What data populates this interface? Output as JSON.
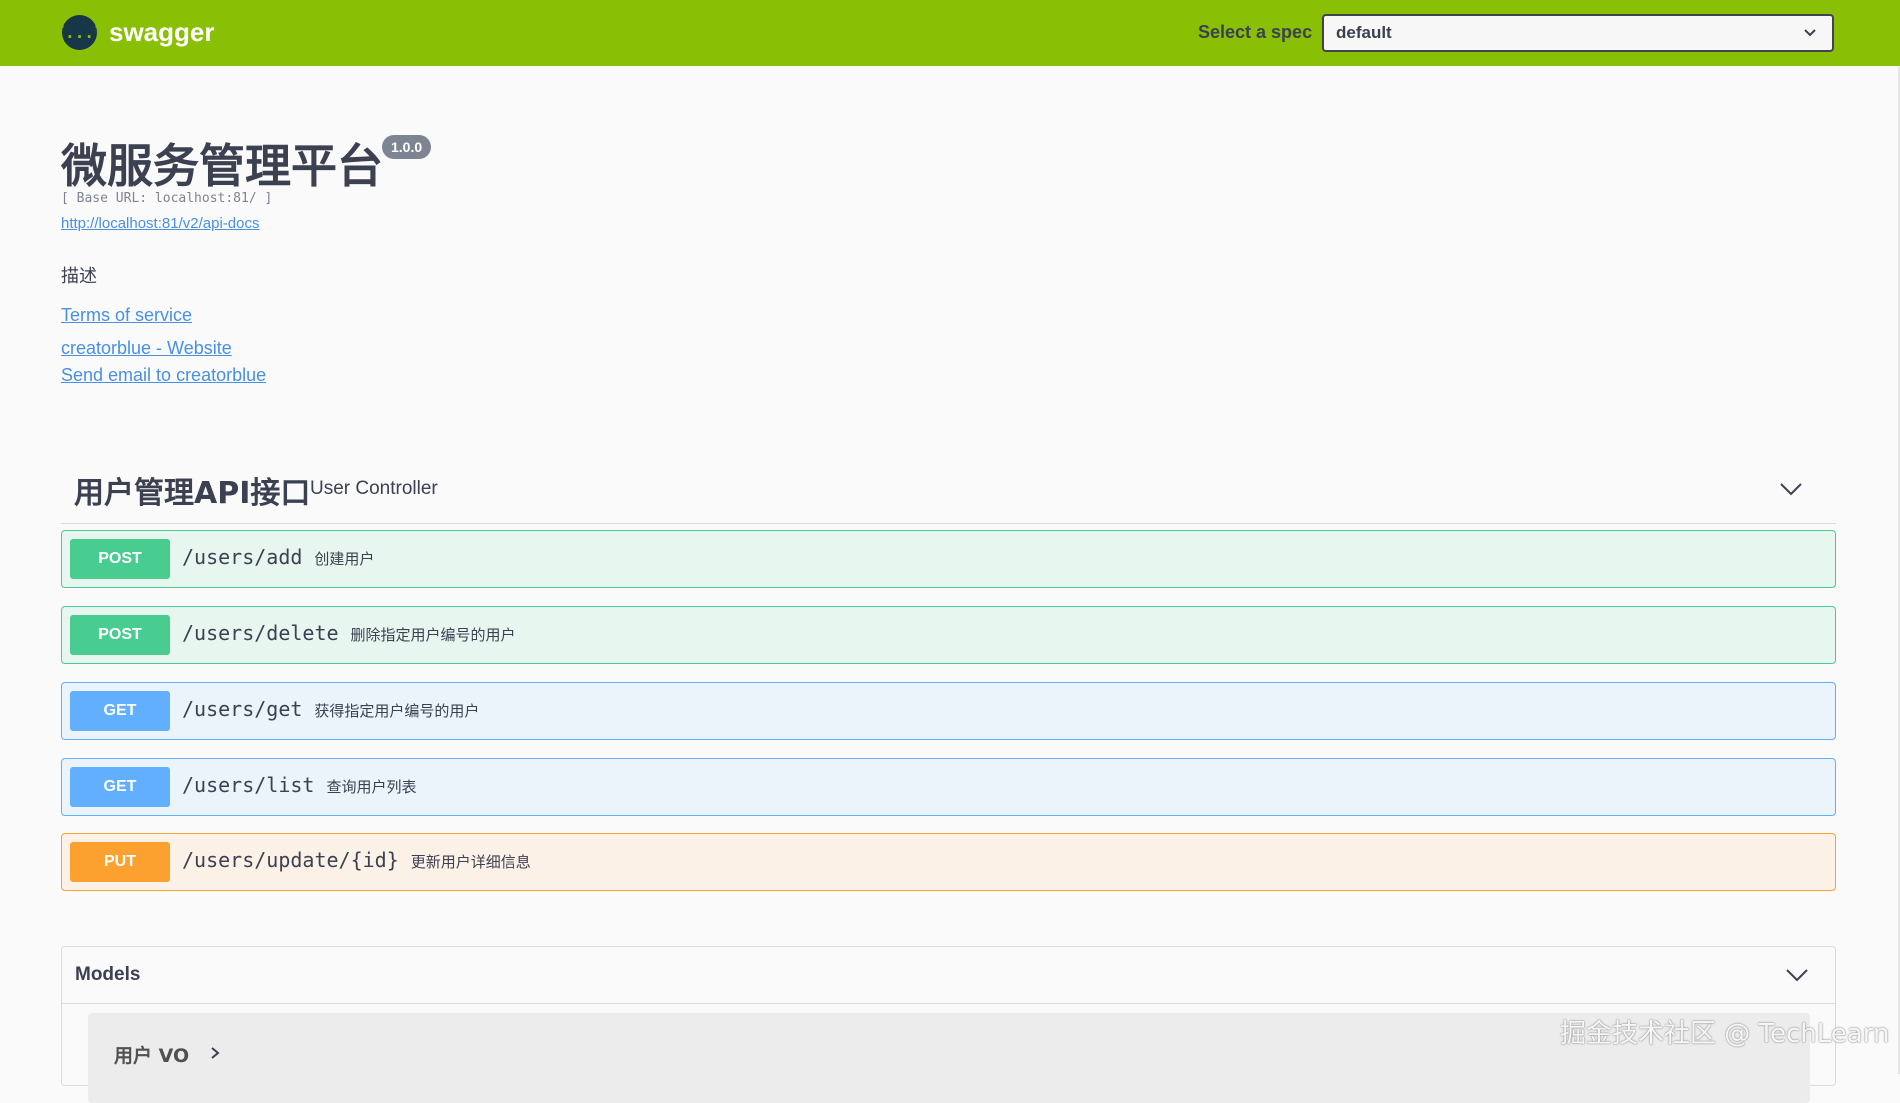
{
  "topbar": {
    "logo_symbol": "{...}",
    "logo_text": "swagger",
    "spec_label": "Select a spec",
    "spec_value": "default",
    "brand_color": "#89bf04"
  },
  "info": {
    "title": "微服务管理平台",
    "version": "1.0.0",
    "base_url": "[ Base URL: localhost:81/ ]",
    "api_docs_link": "http://localhost:81/v2/api-docs",
    "description": "描述",
    "terms_link": "Terms of service",
    "website_link": "creatorblue - Website",
    "email_link": "Send email to creatorblue"
  },
  "tag": {
    "name": "用户管理API接口",
    "description": "User Controller",
    "toggle_icon": "chevron-down-icon"
  },
  "operations": [
    {
      "method": "POST",
      "path": "/users/add",
      "summary": "创建用户",
      "color": "#49cc90"
    },
    {
      "method": "POST",
      "path": "/users/delete",
      "summary": "删除指定用户编号的用户",
      "color": "#49cc90"
    },
    {
      "method": "GET",
      "path": "/users/get",
      "summary": "获得指定用户编号的用户",
      "color": "#61affe"
    },
    {
      "method": "GET",
      "path": "/users/list",
      "summary": "查询用户列表",
      "color": "#61affe"
    },
    {
      "method": "PUT",
      "path": "/users/update/{id}",
      "summary": "更新用户详细信息",
      "color": "#fca130"
    }
  ],
  "models": {
    "title": "Models",
    "items": [
      {
        "name": "用户 VO"
      }
    ]
  },
  "watermark": "掘金技术社区 @ TechLearn"
}
